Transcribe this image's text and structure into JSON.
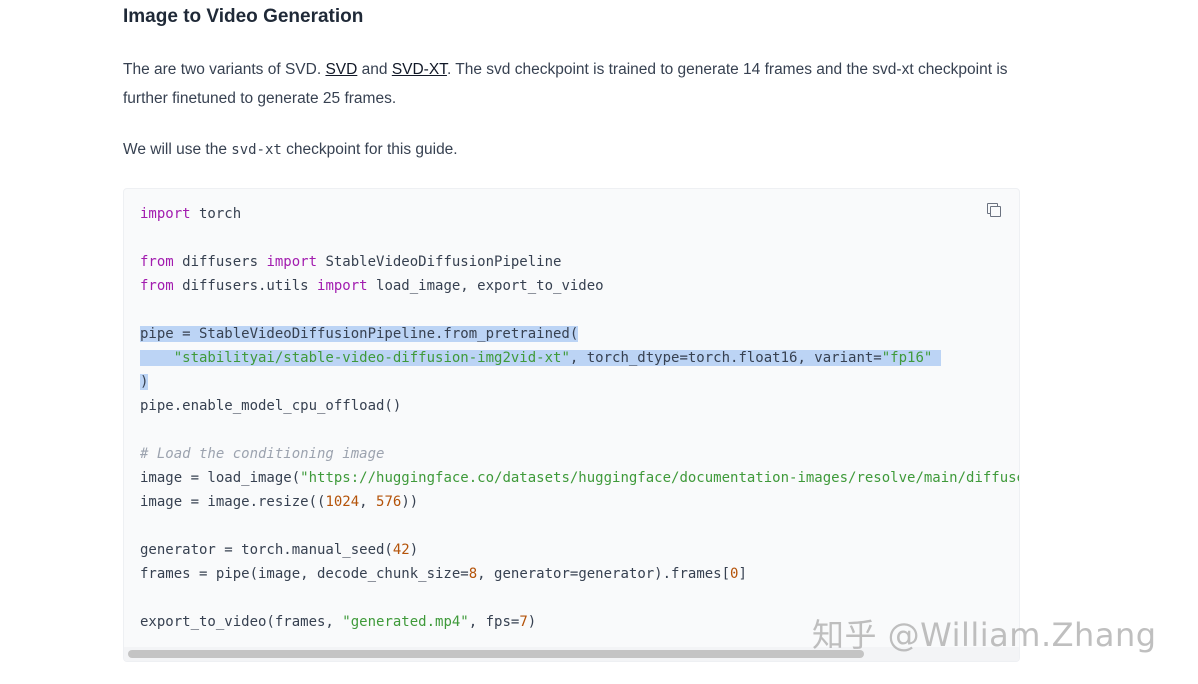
{
  "section": {
    "heading": "Image to Video Generation",
    "para1": {
      "before": "The are two variants of SVD. ",
      "link1": "SVD",
      "between": " and ",
      "link2": "SVD-XT",
      "after": ". The svd checkpoint is trained to generate 14 frames and the svd-xt checkpoint is further finetuned to generate 25 frames."
    },
    "para2": {
      "before": "We will use the ",
      "code": "svd-xt",
      "after": " checkpoint for this guide."
    }
  },
  "code_block": {
    "copy_icon": "copy-icon",
    "lines": [
      {
        "tokens": [
          {
            "t": "import",
            "c": "kw"
          },
          {
            "t": " torch",
            "c": ""
          }
        ]
      },
      {
        "tokens": []
      },
      {
        "tokens": [
          {
            "t": "from",
            "c": "kw"
          },
          {
            "t": " diffusers ",
            "c": ""
          },
          {
            "t": "import",
            "c": "kw"
          },
          {
            "t": " StableVideoDiffusionPipeline",
            "c": ""
          }
        ]
      },
      {
        "tokens": [
          {
            "t": "from",
            "c": "kw"
          },
          {
            "t": " diffusers.utils ",
            "c": ""
          },
          {
            "t": "import",
            "c": "kw"
          },
          {
            "t": " load_image, export_to_video",
            "c": ""
          }
        ]
      },
      {
        "tokens": []
      },
      {
        "selected": true,
        "tokens": [
          {
            "t": "pipe = StableVideoDiffusionPipeline.from_pretrained(",
            "c": ""
          }
        ]
      },
      {
        "selected": true,
        "tokens": [
          {
            "t": "    ",
            "c": ""
          },
          {
            "t": "\"stabilityai/stable-video-diffusion-img2vid-xt\"",
            "c": "str"
          },
          {
            "t": ", torch_dtype=torch.float16, variant=",
            "c": ""
          },
          {
            "t": "\"fp16\"",
            "c": "str"
          },
          {
            "t": " ",
            "c": ""
          }
        ]
      },
      {
        "selected": true,
        "tokens": [
          {
            "t": ")",
            "c": ""
          }
        ]
      },
      {
        "tokens": [
          {
            "t": "pipe.enable_model_cpu_offload()",
            "c": ""
          }
        ]
      },
      {
        "tokens": []
      },
      {
        "tokens": [
          {
            "t": "# Load the conditioning image",
            "c": "cmt"
          }
        ]
      },
      {
        "tokens": [
          {
            "t": "image = load_image(",
            "c": ""
          },
          {
            "t": "\"https://huggingface.co/datasets/huggingface/documentation-images/resolve/main/diffuse",
            "c": "str"
          }
        ]
      },
      {
        "tokens": [
          {
            "t": "image = image.resize((",
            "c": ""
          },
          {
            "t": "1024",
            "c": "num"
          },
          {
            "t": ", ",
            "c": ""
          },
          {
            "t": "576",
            "c": "num"
          },
          {
            "t": "))",
            "c": ""
          }
        ]
      },
      {
        "tokens": []
      },
      {
        "tokens": [
          {
            "t": "generator = torch.manual_seed(",
            "c": ""
          },
          {
            "t": "42",
            "c": "num"
          },
          {
            "t": ")",
            "c": ""
          }
        ]
      },
      {
        "tokens": [
          {
            "t": "frames = pipe(image, decode_chunk_size=",
            "c": ""
          },
          {
            "t": "8",
            "c": "num"
          },
          {
            "t": ", generator=generator).frames[",
            "c": ""
          },
          {
            "t": "0",
            "c": "num"
          },
          {
            "t": "]",
            "c": ""
          }
        ]
      },
      {
        "tokens": []
      },
      {
        "tokens": [
          {
            "t": "export_to_video(frames, ",
            "c": ""
          },
          {
            "t": "\"generated.mp4\"",
            "c": "str"
          },
          {
            "t": ", fps=",
            "c": ""
          },
          {
            "t": "7",
            "c": "num"
          },
          {
            "t": ")",
            "c": ""
          }
        ]
      }
    ],
    "horizontal_scroll_fraction_visible": 0.83
  },
  "watermark": "知乎 @William.Zhang",
  "colors": {
    "keyword": "#a21caf",
    "string": "#3f9a3a",
    "number": "#b45309",
    "comment": "#9ca3af",
    "selection": "#bcd4f5",
    "code_bg": "#f9fafb"
  }
}
